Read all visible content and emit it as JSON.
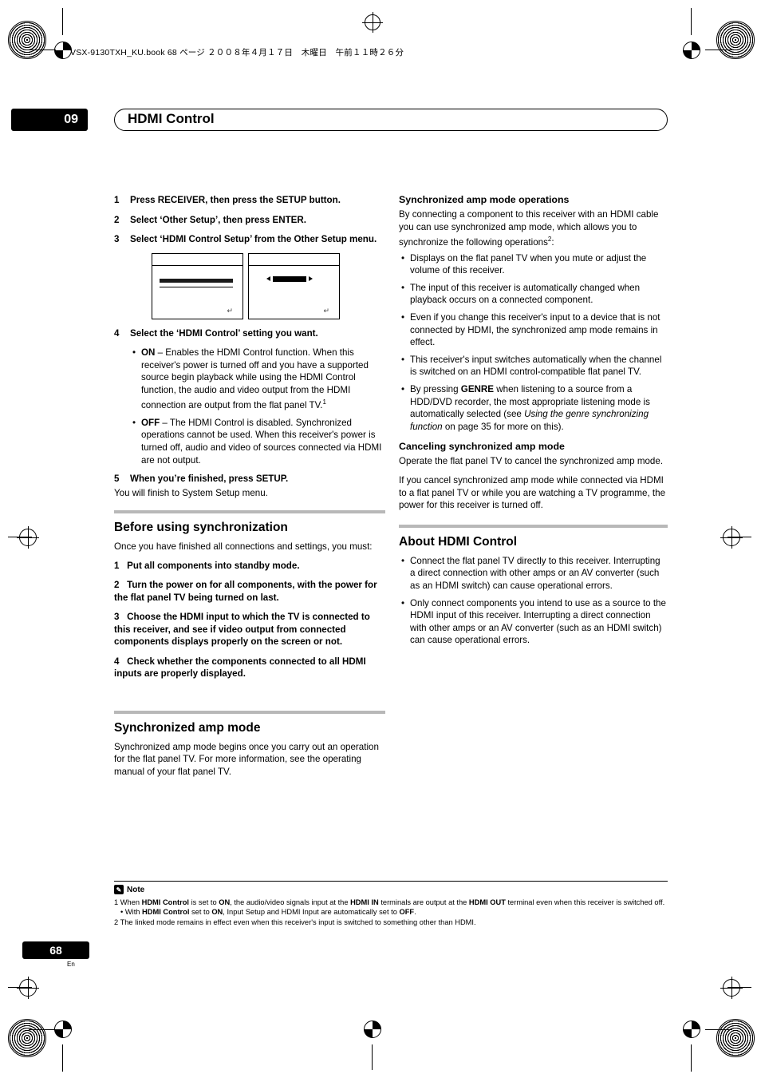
{
  "header": {
    "book_line": "VSX-9130TXH_KU.book  68 ページ  ２００８年４月１７日　木曜日　午前１１時２６分",
    "chapter_number": "09",
    "chapter_title": "HDMI Control"
  },
  "left_column": {
    "steps_top": [
      {
        "num": "1",
        "text": "Press RECEIVER, then press the SETUP button."
      },
      {
        "num": "2",
        "text": "Select ‘Other Setup’, then press ENTER."
      },
      {
        "num": "3",
        "text": "Select ‘HDMI Control Setup’ from the Other Setup menu."
      }
    ],
    "step4_heading": {
      "num": "4",
      "text": "Select the ‘HDMI Control’ setting you want."
    },
    "step4_bullets": [
      {
        "label": "ON",
        "text": " – Enables the HDMI Control function. When this receiver's power is turned off and you have a supported source begin playback while using the HDMI Control function, the audio and video output from the HDMI connection are output from the flat panel TV.",
        "footnote": "1"
      },
      {
        "label": "OFF",
        "text": " – The HDMI Control is disabled. Synchronized operations cannot be used. When this receiver's power is turned off, audio and video of sources connected via HDMI are not output.",
        "footnote": ""
      }
    ],
    "step5": {
      "num": "5",
      "text": "When you’re finished, press SETUP."
    },
    "step5_follow": "You will finish to System Setup menu.",
    "section_before": {
      "title": "Before using synchronization",
      "intro": "Once you have finished all connections and settings, you must:",
      "steps": [
        {
          "num": "1",
          "text": "Put all components into standby mode."
        },
        {
          "num": "2",
          "text": "Turn the power on for all components, with the power for the flat panel TV being turned on last."
        },
        {
          "num": "3",
          "text": "Choose the HDMI input to which the TV is connected to this receiver, and see if video output from connected components displays properly on the screen or not."
        },
        {
          "num": "4",
          "text": "Check whether the components connected to all HDMI inputs are properly displayed."
        }
      ]
    },
    "section_sync": {
      "title": "Synchronized amp mode",
      "body": "Synchronized amp mode begins once you carry out an operation for the flat panel TV. For more information, see the operating manual of your flat panel TV."
    }
  },
  "right_column": {
    "sync_ops": {
      "title": "Synchronized amp mode operations",
      "intro_1": "By connecting a component to this receiver with an HDMI cable you can use synchronized amp mode, which allows you to synchronize the following operations",
      "intro_footnote": "2",
      "intro_2": ":",
      "bullets": [
        "Displays on the flat panel TV when you mute or adjust the volume of this receiver.",
        "The input of this receiver is automatically changed when playback occurs on a connected component.",
        "Even if you change this receiver's input to a device that is not connected by HDMI, the synchronized amp mode remains in effect.",
        "This receiver's input switches automatically when the channel is switched on an HDMI control-compatible flat panel TV."
      ],
      "genre_bullet": {
        "pre": "By pressing ",
        "bold": "GENRE",
        "mid": " when listening to a source from a HDD/DVD recorder, the most appropriate listening mode is automatically selected (see ",
        "italic": "Using the genre synchronizing function",
        "post": " on page 35 for more on this)."
      }
    },
    "canceling": {
      "title": "Canceling synchronized amp mode",
      "para1": "Operate the flat panel TV to cancel the synchronized amp mode.",
      "para2": "If you cancel synchronized amp mode while connected via HDMI to a flat panel TV or while you are watching a TV programme, the power for this receiver is turned off."
    },
    "about": {
      "title": "About HDMI Control",
      "bullets": [
        "Connect the flat panel TV directly to this receiver. Interrupting a direct connection with other amps or an AV converter (such as an HDMI switch) can cause operational errors.",
        "Only connect components you intend to use as a source to the HDMI input of this receiver. Interrupting a direct connection with other amps or an AV converter (such as an HDMI switch) can cause operational errors."
      ]
    }
  },
  "note": {
    "label": "Note",
    "icon": "note-icon",
    "items": [
      {
        "marker": "1",
        "segments": [
          {
            "t": "  When ",
            "b": false
          },
          {
            "t": "HDMI Control",
            "b": true
          },
          {
            "t": " is set to ",
            "b": false
          },
          {
            "t": "ON",
            "b": true
          },
          {
            "t": ", the audio/video signals input at the ",
            "b": false
          },
          {
            "t": "HDMI IN",
            "b": true
          },
          {
            "t": " terminals are output at the ",
            "b": false
          },
          {
            "t": "HDMI OUT",
            "b": true
          },
          {
            "t": " terminal even when this receiver is switched off.",
            "b": false
          }
        ]
      },
      {
        "marker": "•",
        "segments": [
          {
            "t": " With ",
            "b": false
          },
          {
            "t": "HDMI Control",
            "b": true
          },
          {
            "t": " set to ",
            "b": false
          },
          {
            "t": "ON",
            "b": true
          },
          {
            "t": ", Input Setup and HDMI Input are automatically set to ",
            "b": false
          },
          {
            "t": "OFF",
            "b": true
          },
          {
            "t": ".",
            "b": false
          }
        ]
      },
      {
        "marker": "2",
        "segments": [
          {
            "t": " The linked mode remains in effect even when this receiver's input is switched to something other than HDMI.",
            "b": false
          }
        ]
      }
    ]
  },
  "footer": {
    "page_number": "68",
    "language": "En"
  },
  "osd_screens": {
    "return_glyph": "↵"
  }
}
